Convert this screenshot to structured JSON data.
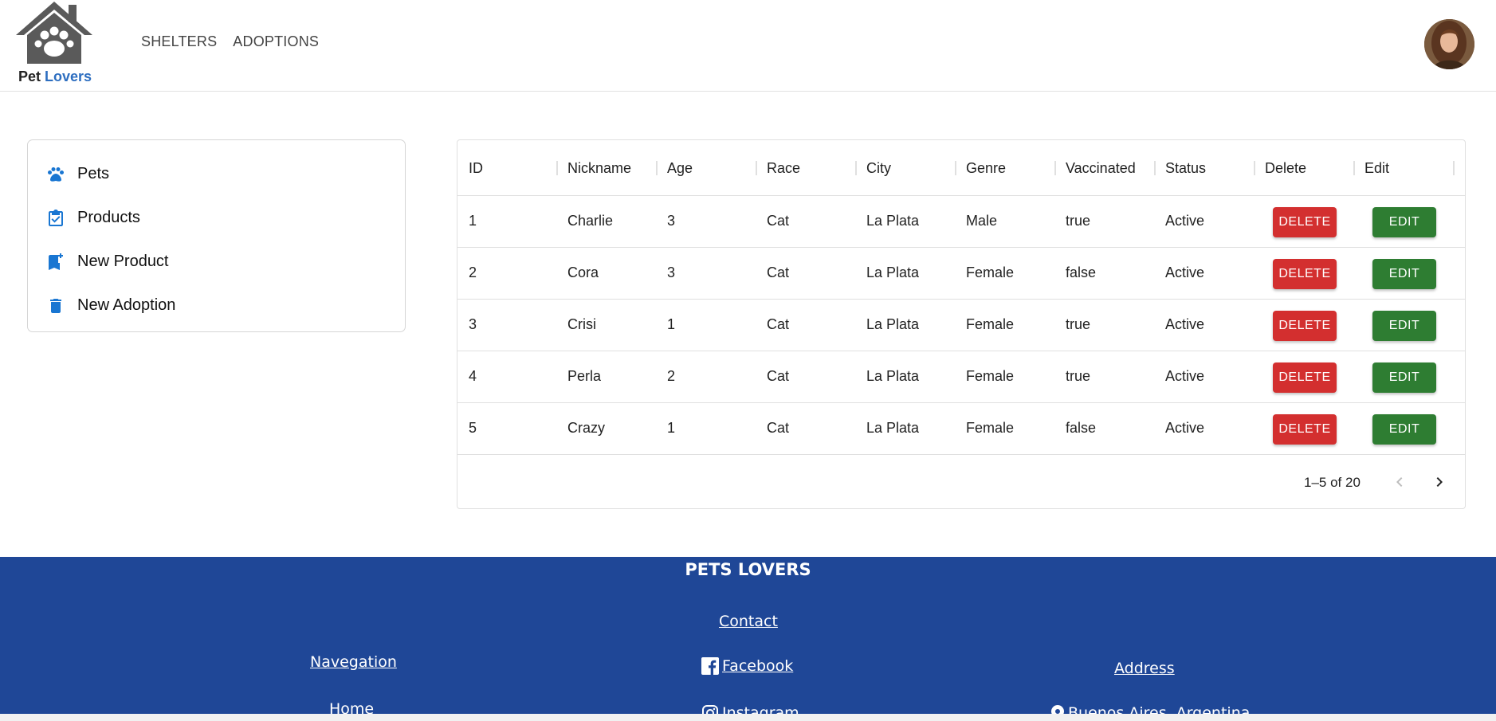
{
  "brand": {
    "word1": "Pet",
    "word2": "Lovers",
    "accent": "#2d6ec0"
  },
  "nav": {
    "shelters": "SHELTERS",
    "adoptions": "ADOPTIONS"
  },
  "sidebar": {
    "items": [
      {
        "label": "Pets",
        "icon": "paw-icon"
      },
      {
        "label": "Products",
        "icon": "clipboard-check-icon"
      },
      {
        "label": "New Product",
        "icon": "bookmark-add-icon"
      },
      {
        "label": "New Adoption",
        "icon": "trash-icon"
      }
    ],
    "icon_color": "#1976d2"
  },
  "table": {
    "headers": [
      "ID",
      "Nickname",
      "Age",
      "Race",
      "City",
      "Genre",
      "Vaccinated",
      "Status",
      "Delete",
      "Edit"
    ],
    "rows": [
      {
        "id": "1",
        "nickname": "Charlie",
        "age": "3",
        "race": "Cat",
        "city": "La Plata",
        "genre": "Male",
        "vaccinated": "true",
        "status": "Active"
      },
      {
        "id": "2",
        "nickname": "Cora",
        "age": "3",
        "race": "Cat",
        "city": "La Plata",
        "genre": "Female",
        "vaccinated": "false",
        "status": "Active"
      },
      {
        "id": "3",
        "nickname": "Crisi",
        "age": "1",
        "race": "Cat",
        "city": "La Plata",
        "genre": "Female",
        "vaccinated": "true",
        "status": "Active"
      },
      {
        "id": "4",
        "nickname": "Perla",
        "age": "2",
        "race": "Cat",
        "city": "La Plata",
        "genre": "Female",
        "vaccinated": "true",
        "status": "Active"
      },
      {
        "id": "5",
        "nickname": "Crazy",
        "age": "1",
        "race": "Cat",
        "city": "La Plata",
        "genre": "Female",
        "vaccinated": "false",
        "status": "Active"
      }
    ],
    "delete_label": "DELETE",
    "edit_label": "EDIT",
    "delete_color": "#d32f2f",
    "edit_color": "#2e7d32",
    "pagination": {
      "range": "1–5 of 20"
    }
  },
  "footer": {
    "title": "PETS LOVERS",
    "contact": "Contact",
    "navigation": "Navegation",
    "home": "Home",
    "facebook": "Facebook",
    "instagram": "Instagram",
    "address": "Address",
    "location": "Buenos Aires, Argentina",
    "bg_color": "#1f4797"
  }
}
